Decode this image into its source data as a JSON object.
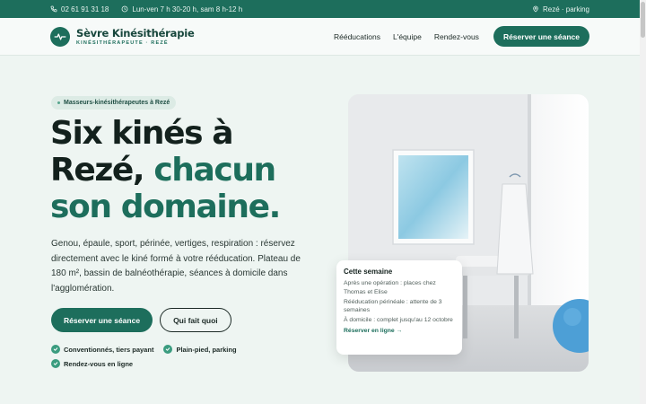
{
  "topbar": {
    "phone": "02 61 91 31 18",
    "hours": "Lun-ven 7 h 30-20 h, sam 8 h-12 h",
    "location": "Rezé · parking"
  },
  "header": {
    "brand_name": "Sèvre Kinésithérapie",
    "brand_sub": "KINÉSITHÉRAPEUTE · REZÉ",
    "nav": [
      "Rééducations",
      "L'équipe",
      "Rendez-vous"
    ],
    "cta": "Réserver une séance"
  },
  "hero": {
    "pill": "Masseurs-kinésithérapeutes à Rezé",
    "title_line1": "Six kinés à",
    "title_line2_plain": "Rezé, ",
    "title_line2_accent": "chacun",
    "title_line3_accent": "son domaine.",
    "text": "Genou, épaule, sport, périnée, vertiges, respiration : réservez directement avec le kiné formé à votre rééducation. Plateau de 180 m², bassin de balnéothérapie, séances à domicile dans l'agglomération.",
    "cta_primary": "Réserver une séance",
    "cta_secondary": "Qui fait quoi",
    "features": [
      "Conventionnés, tiers payant",
      "Plain-pied, parking",
      "Rendez-vous en ligne"
    ]
  },
  "card": {
    "title": "Cette semaine",
    "lines": [
      "Après une opération : places chez Thomas et Elise",
      "Rééducation périnéale : attente de 3 semaines",
      "À domicile : complet jusqu'au 12 octobre"
    ],
    "link": "Réserver en ligne →"
  },
  "colors": {
    "brand": "#1d6e5c",
    "background": "#eef5f2",
    "text": "#13211d"
  },
  "icons": [
    "phone-icon",
    "clock-icon",
    "location-pin-icon",
    "heartbeat-logo-icon",
    "check-icon"
  ]
}
